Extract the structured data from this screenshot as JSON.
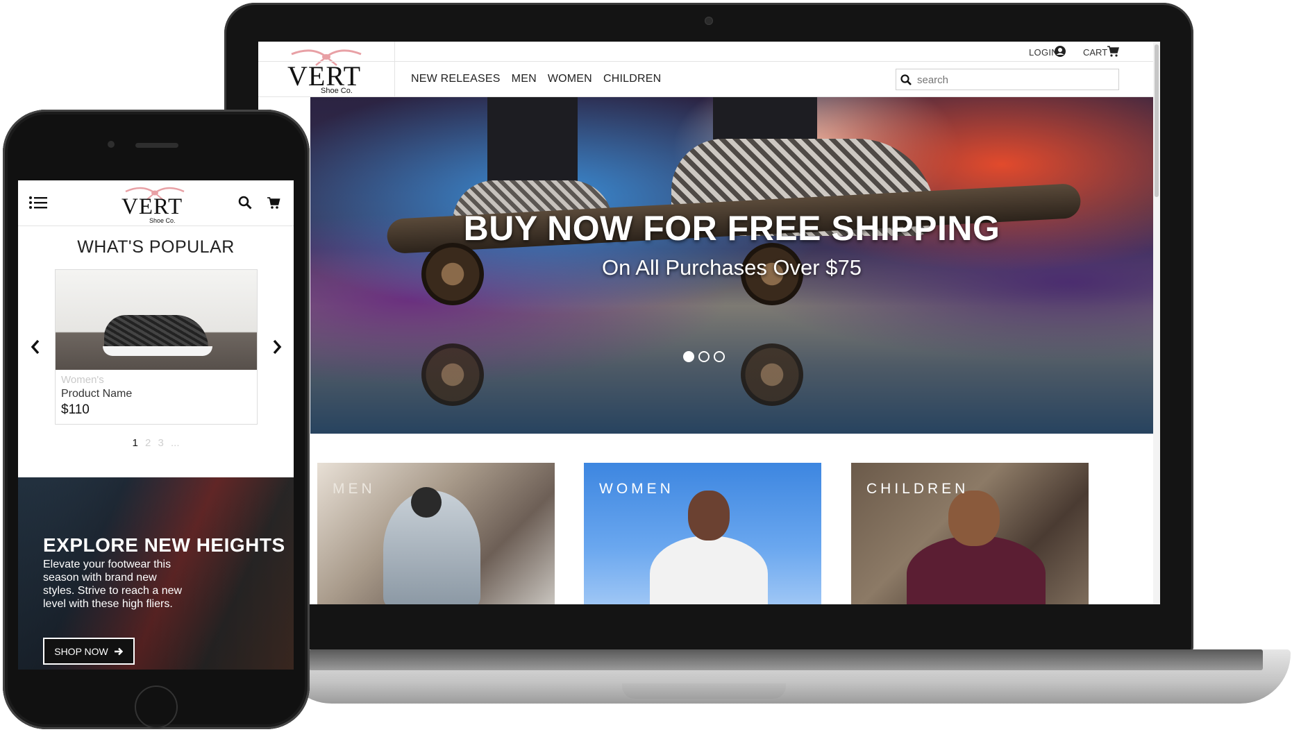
{
  "desktop": {
    "brand": {
      "name": "VERT",
      "sub": "Shoe Co."
    },
    "top_links": {
      "login": "LOGIN",
      "cart": "CART"
    },
    "nav": [
      "NEW RELEASES",
      "MEN",
      "WOMEN",
      "CHILDREN"
    ],
    "search": {
      "placeholder": "search",
      "value": ""
    },
    "hero": {
      "title": "BUY NOW FOR FREE SHIPPING",
      "subtitle": "On All Purchases Over $75",
      "slides": 3,
      "active_slide": 1
    },
    "categories": [
      "MEN",
      "WOMEN",
      "CHILDREN"
    ]
  },
  "mobile": {
    "brand": {
      "name": "VERT",
      "sub": "Shoe Co."
    },
    "section_title": "WHAT'S POPULAR",
    "product": {
      "category": "Women's",
      "name": "Product Name",
      "price": "$110"
    },
    "pager": [
      "1",
      "2",
      "3",
      "..."
    ],
    "promo": {
      "title": "EXPLORE NEW HEIGHTS",
      "text": "Elevate your footwear this season with brand new styles. Strive to reach a new level with these high fliers.",
      "button": "SHOP NOW"
    }
  },
  "icons": {
    "login": "user-circle-icon",
    "cart": "cart-icon",
    "search": "search-icon",
    "menu": "hamburger-menu-icon",
    "prev": "chevron-left-icon",
    "next": "chevron-right-icon",
    "shop_now": "arrow-right-icon"
  },
  "colors": {
    "brand_ribbon": "#e8a0a5",
    "text": "#222222",
    "accent_white": "#ffffff"
  }
}
